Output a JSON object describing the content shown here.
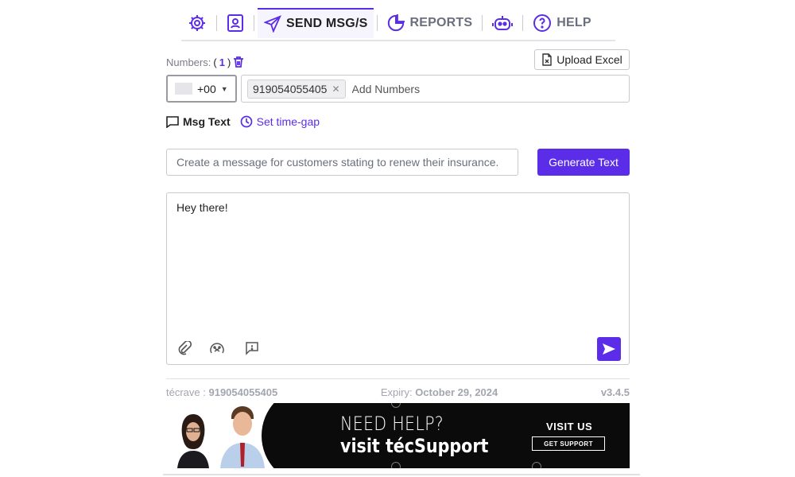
{
  "nav": {
    "items": [
      {
        "icon": "gear-icon",
        "label": ""
      },
      {
        "icon": "contact-card-icon",
        "label": ""
      },
      {
        "icon": "paper-plane-icon",
        "label": "SEND MSG/S"
      },
      {
        "icon": "pie-chart-icon",
        "label": "REPORTS"
      },
      {
        "icon": "robot-icon",
        "label": ""
      },
      {
        "icon": "question-icon",
        "label": "HELP"
      }
    ],
    "active": "SEND MSG/S",
    "accent": "#5b2de8"
  },
  "numbers": {
    "label": "Numbers:",
    "open_paren": "(",
    "count": "1",
    "close_paren": ")",
    "upload_label": "Upload Excel",
    "country_code": "+00",
    "chips": [
      "919054055405"
    ],
    "add_placeholder": "Add Numbers"
  },
  "options": {
    "msg_text_label": "Msg Text",
    "time_gap_label": "Set time-gap"
  },
  "prompt": {
    "placeholder": "Create a message for customers stating to renew their insurance.",
    "generate_label": "Generate Text"
  },
  "message": {
    "value": "Hey there!"
  },
  "footer": {
    "account_label": "técrave :",
    "account_number": "919054055405",
    "expiry_label": "Expiry:",
    "expiry_date": "October 29, 2024",
    "version": "v3.4.5"
  },
  "banner": {
    "title": "NEED HELP?",
    "subtitle": "visit técSupport",
    "visit_us": "VISIT US",
    "cta": "GET SUPPORT"
  }
}
